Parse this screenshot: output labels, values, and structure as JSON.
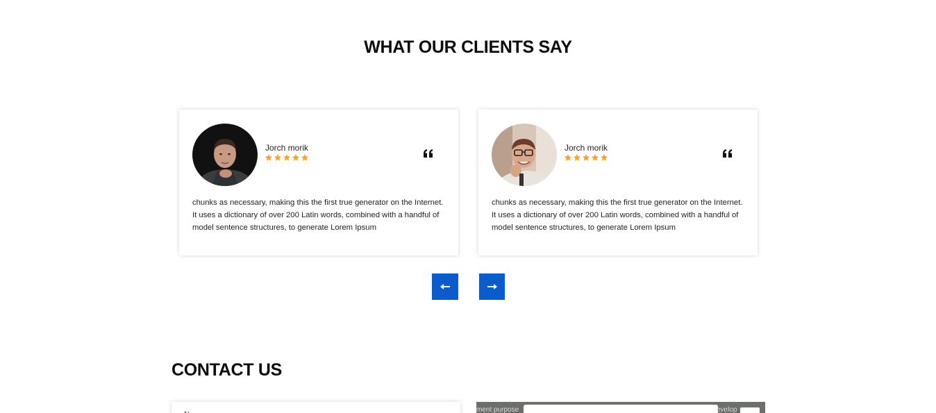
{
  "testimonials": {
    "title": "WHAT OUR CLIENTS SAY",
    "cards": [
      {
        "name": "Jorch morik",
        "rating": 5,
        "text": "chunks as necessary, making this the first true generator on the Internet. It uses a dictionary of over 200 Latin words, combined with a handful of model sentence structures, to generate Lorem Ipsum",
        "avatar_icon": "person-dark-shirt-avatar"
      },
      {
        "name": "Jorch morik",
        "rating": 5,
        "text": "chunks as necessary, making this the first true generator on the Internet. It uses a dictionary of over 200 Latin words, combined with a handful of model sentence structures, to generate Lorem Ipsum",
        "avatar_icon": "person-glasses-avatar"
      }
    ],
    "prev_icon": "arrow-left-icon",
    "next_icon": "arrow-right-icon"
  },
  "contact": {
    "title": "CONTACT US",
    "form_first_label": "N",
    "map_text_left": "ment purpose",
    "map_text_right": "evelop"
  },
  "colors": {
    "accent_blue": "#0a5bcc",
    "star_orange": "#f5a623"
  }
}
